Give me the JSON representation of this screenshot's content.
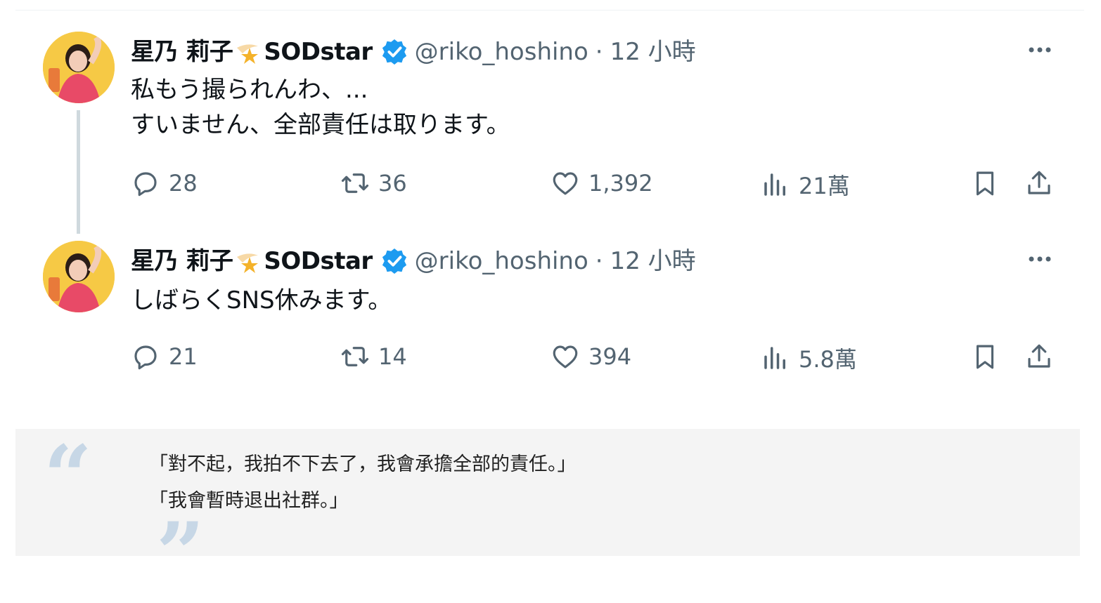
{
  "tweets": [
    {
      "display_name": "星乃 莉子",
      "brand": "SODstar",
      "handle": "@riko_hoshino",
      "separator": "·",
      "time": "12 小時",
      "text": "私もう撮られんわ、...\nすいません、全部責任は取ります。",
      "reply_count": "28",
      "retweet_count": "36",
      "like_count": "1,392",
      "view_count": "21萬"
    },
    {
      "display_name": "星乃 莉子",
      "brand": "SODstar",
      "handle": "@riko_hoshino",
      "separator": "·",
      "time": "12 小時",
      "text": "しばらくSNS休みます。",
      "reply_count": "21",
      "retweet_count": "14",
      "like_count": "394",
      "view_count": "5.8萬"
    }
  ],
  "quote": {
    "line1": "「對不起，我拍不下去了，我會承擔全部的責任。」",
    "line2": "「我會暫時退出社群。」"
  },
  "colors": {
    "text": "#0f1419",
    "muted": "#536471",
    "verified": "#1d9bf0",
    "thread_line": "#cfd9de",
    "quote_bg": "#f4f4f4",
    "quote_marks": "#c7d7e6"
  },
  "icons": [
    "star-icon",
    "verified-icon",
    "more-icon",
    "reply-icon",
    "retweet-icon",
    "like-icon",
    "views-icon",
    "bookmark-icon",
    "share-icon",
    "open-quote-icon",
    "close-quote-icon"
  ]
}
